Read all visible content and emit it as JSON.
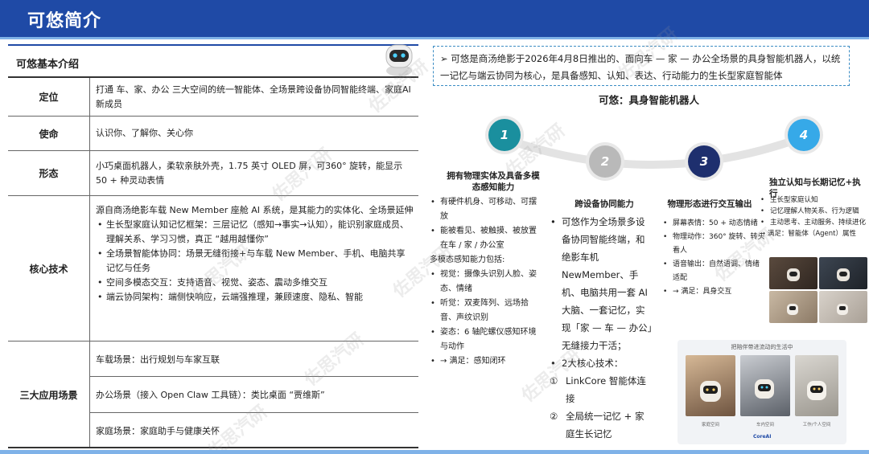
{
  "header": {
    "title": "可悠简介"
  },
  "table": {
    "title": "可悠基本介绍",
    "rows": {
      "positioning": {
        "label": "定位",
        "text": "打通 车、家、办公 三大空间的统一智能体、全场景跨设备协同智能终端、家庭AI新成员"
      },
      "mission": {
        "label": "使命",
        "text": "认识你、了解你、关心你"
      },
      "form": {
        "label": "形态",
        "text": "小巧桌面机器人，柔软亲肤外壳，1.75 英寸 OLED 屏，可360° 旋转，能显示 50 + 种灵动表情"
      },
      "core": {
        "label": "核心技术",
        "intro": "源自商汤绝影车载 New Member 座舱 AI 系统，是其能力的实体化、全场景延伸",
        "items": [
          "生长型家庭认知记忆框架：三层记忆（感知→事实→认知），能识别家庭成员、理解关系、学习习惯，真正 “越用越懂你”",
          "全场景智能体协同：场景无缝衔接+与车载 New Member、手机、电脑共享记忆与任务",
          "空间多模态交互：支持语音、视觉、姿态、震动多维交互",
          "端云协同架构：端侧快响应，云端强推理，兼顾速度、隐私、智能"
        ]
      },
      "scenarios": {
        "label": "三大应用场景",
        "items": [
          "车载场景：出行规划与车家互联",
          "办公场景（接入 Open Claw 工具链）：类比桌面 “贾维斯”",
          "家庭场景：家庭助手与健康关怀"
        ]
      }
    }
  },
  "intro": {
    "arrow": "➢",
    "text": "可悠是商汤绝影于2026年4月8日推出的、面向车 — 家 — 办公全场景的具身智能机器人，以统一记忆与端云协同为核心，是具备感知、认知、表达、行动能力的生长型家庭智能体"
  },
  "robot_title": "可悠：具身智能机器人",
  "steps": [
    {
      "num": "1",
      "color": "#1a8f9e"
    },
    {
      "num": "2",
      "color": "#b9b9b9"
    },
    {
      "num": "3",
      "color": "#1e2f6e"
    },
    {
      "num": "4",
      "color": "#36a9e8"
    }
  ],
  "col1": {
    "title": "拥有物理实体及具备多模态感知能力",
    "items": [
      "有硬件机身、可移动、可摆放",
      "能被看见、被触摸、被放置在车 / 家 / 办公室"
    ],
    "sub_title": "多模态感知能力包括:",
    "sub_items": [
      "视觉：摄像头识别人脸、姿态、情绪",
      "听觉：双麦阵列、远场拾音、声纹识别",
      "姿态：6 轴陀螺仪感知环境与动作",
      "→ 满足：感知闭环"
    ]
  },
  "col2": {
    "title": "跨设备协同能力",
    "items": [
      "可悠作为全场景多设备协同智能终端，和绝影车机NewMember、手机、电脑共用一套 AI 大脑、一套记忆，实现「家 — 车 — 办公」无缝接力干活；",
      "2大核心技术："
    ],
    "nums": [
      {
        "n": "①",
        "text": "LinkCore 智能体连接"
      },
      {
        "n": "②",
        "text": "全局统一记忆 + 家庭生长记忆"
      }
    ]
  },
  "col3": {
    "title": "物理形态进行交互输出",
    "items": [
      "屏幕表情：50 + 动态情绪",
      "物理动作：360° 旋转、转头看人",
      "语音输出：自然语调、情绪适配",
      "→ 满足：具身交互"
    ]
  },
  "col4": {
    "title": "独立认知与长期记忆+执行",
    "items": [
      "生长型家庭认知",
      "记忆理解人物关系、行为逻辑",
      "主动思考、主动服务、持续进化",
      "→ 满足：智能体（Agent）属性"
    ]
  },
  "bot_card": {
    "title": "把陪伴带进流动的生活中",
    "captions": [
      "家庭空间",
      "车内空间",
      "工作/个人空间"
    ],
    "logo": "CoreAI"
  },
  "watermark": "佐思汽研"
}
